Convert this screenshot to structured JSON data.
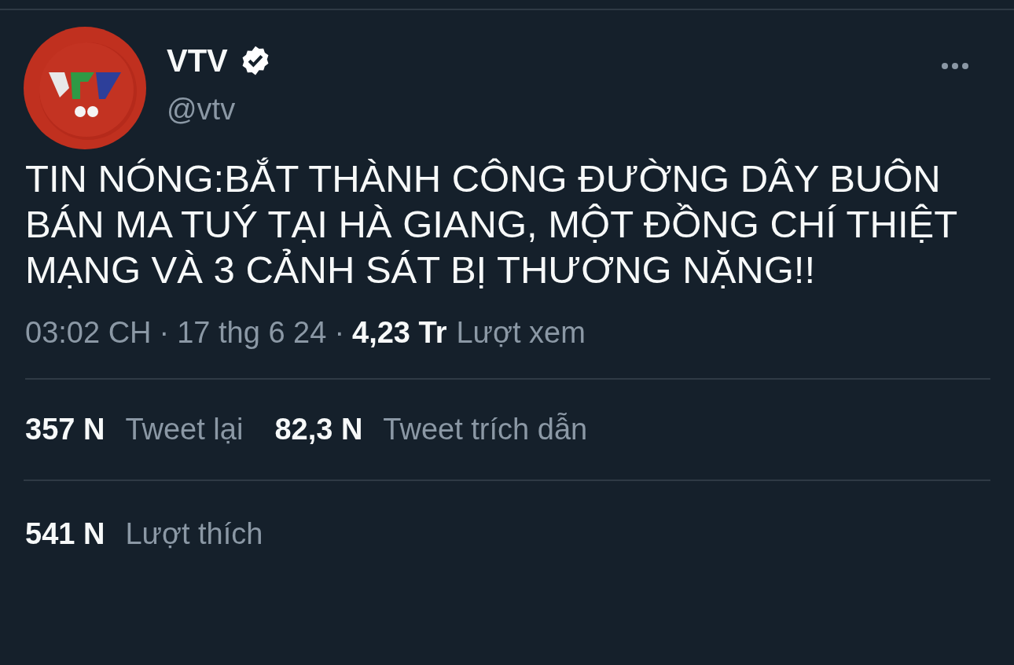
{
  "author": {
    "name": "VTV",
    "verified": true,
    "handle": "@vtv"
  },
  "tweet": {
    "text": "TIN NÓNG:BẮT THÀNH CÔNG ĐƯỜNG DÂY BUÔN BÁN MA TUÝ TẠI HÀ GIANG, MỘT ĐỒNG CHÍ THIỆT MẠNG VÀ 3 CẢNH SÁT BỊ THƯƠNG NẶNG!!"
  },
  "meta": {
    "time": "03:02 CH",
    "separator_1": "·",
    "date": "17 thg 6 24",
    "separator_2": "·",
    "views": "4,23 Tr",
    "views_label": "Lượt xem"
  },
  "stats": [
    {
      "count": "357 N",
      "label": "Tweet lại"
    },
    {
      "count": "82,3 N",
      "label": "Tweet trích dẫn"
    }
  ],
  "likes": {
    "count": "541 N",
    "label": "Lượt thích"
  }
}
